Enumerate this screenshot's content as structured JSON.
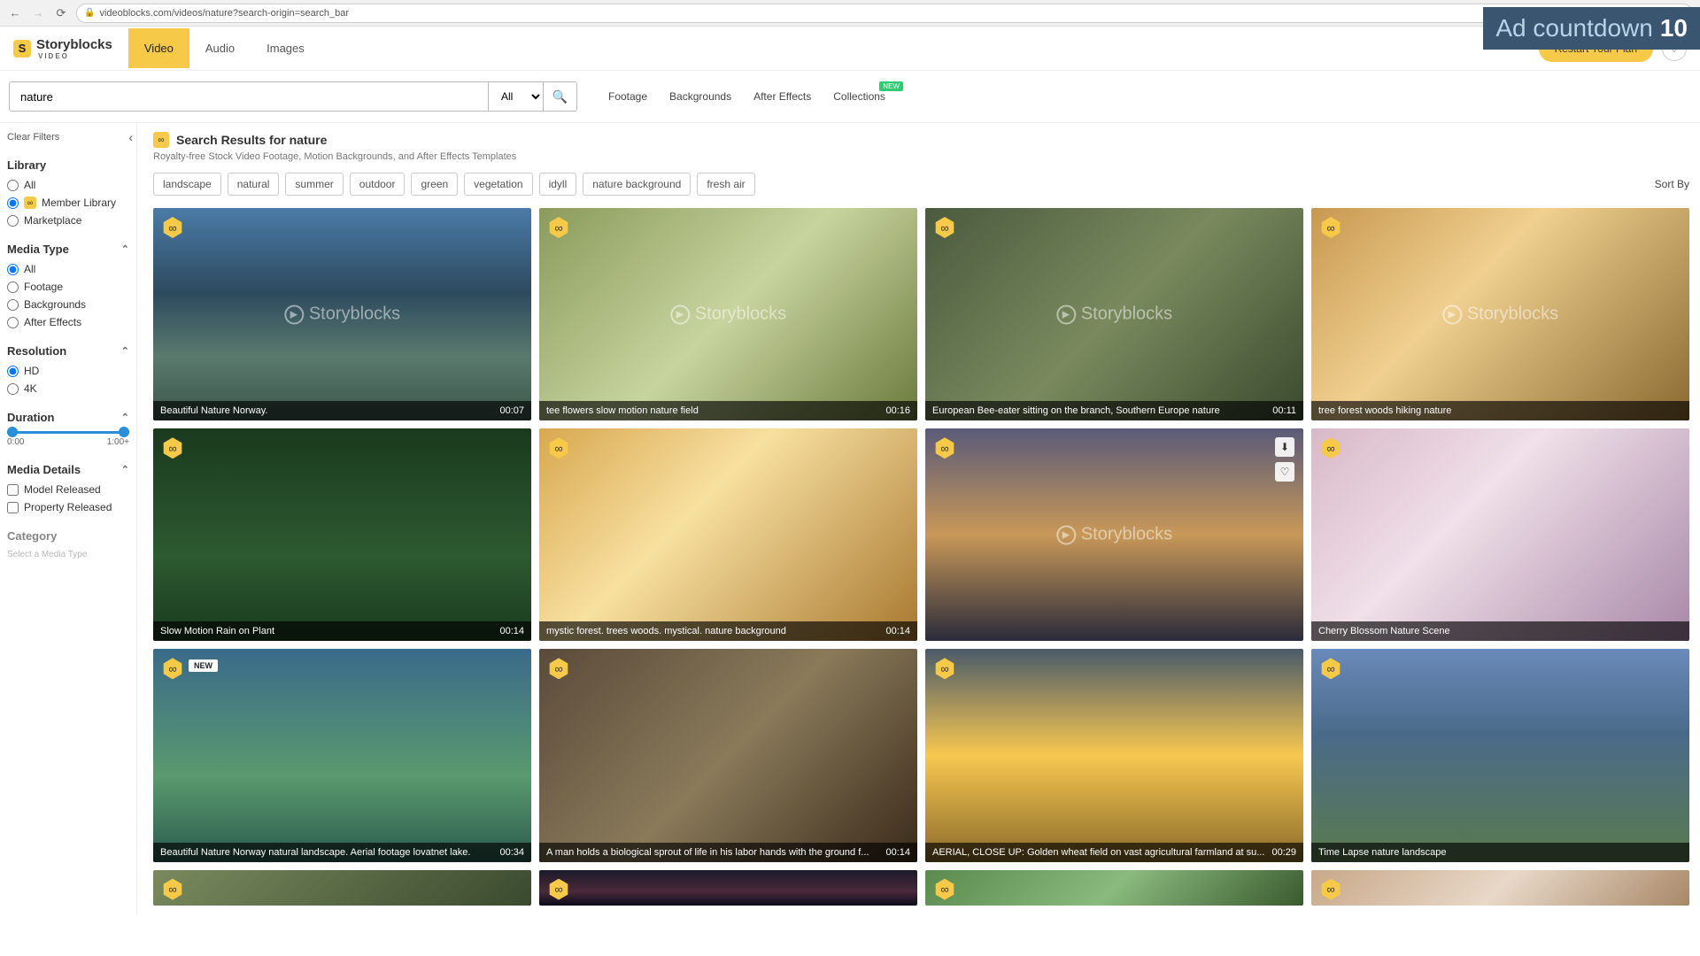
{
  "browser": {
    "url": "videoblocks.com/videos/nature?search-origin=search_bar"
  },
  "ad": {
    "label": "Ad countdown",
    "count": "10"
  },
  "brand": {
    "name": "Storyblocks",
    "sub": "VIDEO"
  },
  "topTabs": [
    {
      "label": "Video",
      "active": true
    },
    {
      "label": "Audio",
      "active": false
    },
    {
      "label": "Images",
      "active": false
    }
  ],
  "topAction": {
    "yellow": "Restart Your Plan"
  },
  "search": {
    "value": "nature",
    "filter": "All"
  },
  "typeLinks": [
    {
      "label": "Footage"
    },
    {
      "label": "Backgrounds"
    },
    {
      "label": "After Effects"
    },
    {
      "label": "Collections",
      "badge": "NEW"
    }
  ],
  "sidebar": {
    "clear": "Clear Filters",
    "library": {
      "title": "Library",
      "opts": [
        {
          "label": "All",
          "sel": false,
          "icon": false
        },
        {
          "label": "Member Library",
          "sel": true,
          "icon": true
        },
        {
          "label": "Marketplace",
          "sel": false,
          "icon": false
        }
      ]
    },
    "mediaType": {
      "title": "Media Type",
      "opts": [
        {
          "label": "All",
          "sel": true
        },
        {
          "label": "Footage",
          "sel": false
        },
        {
          "label": "Backgrounds",
          "sel": false
        },
        {
          "label": "After Effects",
          "sel": false
        }
      ]
    },
    "resolution": {
      "title": "Resolution",
      "opts": [
        {
          "label": "HD",
          "sel": true
        },
        {
          "label": "4K",
          "sel": false
        }
      ]
    },
    "duration": {
      "title": "Duration",
      "min": "0:00",
      "max": "1:00+"
    },
    "mediaDetails": {
      "title": "Media Details",
      "opts": [
        {
          "label": "Model Released"
        },
        {
          "label": "Property Released"
        }
      ]
    },
    "category": {
      "title": "Category",
      "note": "Select a Media Type"
    }
  },
  "results": {
    "heading": "Search Results for nature",
    "sub": "Royalty-free Stock Video Footage, Motion Backgrounds, and After Effects Templates",
    "tags": [
      "landscape",
      "natural",
      "summer",
      "outdoor",
      "green",
      "vegetation",
      "idyll",
      "nature background",
      "fresh air"
    ],
    "sortLabel": "Sort By"
  },
  "videos": [
    {
      "title": "Beautiful Nature Norway.",
      "dur": "00:07",
      "wm": true,
      "g": "g1"
    },
    {
      "title": "tee flowers slow motion nature field",
      "dur": "00:16",
      "wm": true,
      "g": "g2"
    },
    {
      "title": "European Bee-eater sitting on the branch, Southern Europe nature",
      "dur": "00:11",
      "wm": true,
      "g": "g3"
    },
    {
      "title": "tree forest woods hiking nature",
      "dur": "",
      "wm": true,
      "g": "g4"
    },
    {
      "title": "Slow Motion Rain on Plant",
      "dur": "00:14",
      "wm": false,
      "g": "g5"
    },
    {
      "title": "mystic forest. trees woods. mystical. nature background",
      "dur": "00:14",
      "wm": false,
      "g": "g6"
    },
    {
      "title": "",
      "dur": "",
      "wm": true,
      "g": "g7",
      "hover": true
    },
    {
      "title": "Cherry Blossom Nature Scene",
      "dur": "",
      "wm": false,
      "g": "g8"
    },
    {
      "title": "Beautiful Nature Norway natural landscape. Aerial footage lovatnet lake.",
      "dur": "00:34",
      "wm": false,
      "g": "g9",
      "newBadge": true
    },
    {
      "title": "A man holds a biological sprout of life in his labor hands with the ground f...",
      "dur": "00:14",
      "wm": false,
      "g": "g10"
    },
    {
      "title": "AERIAL, CLOSE UP: Golden wheat field on vast agricultural farmland at su...",
      "dur": "00:29",
      "wm": false,
      "g": "g11"
    },
    {
      "title": "Time Lapse nature landscape",
      "dur": "",
      "wm": false,
      "g": "g12"
    }
  ],
  "partial": [
    {
      "g": "g13"
    },
    {
      "g": "g14"
    },
    {
      "g": "g15"
    },
    {
      "g": "g16"
    }
  ]
}
